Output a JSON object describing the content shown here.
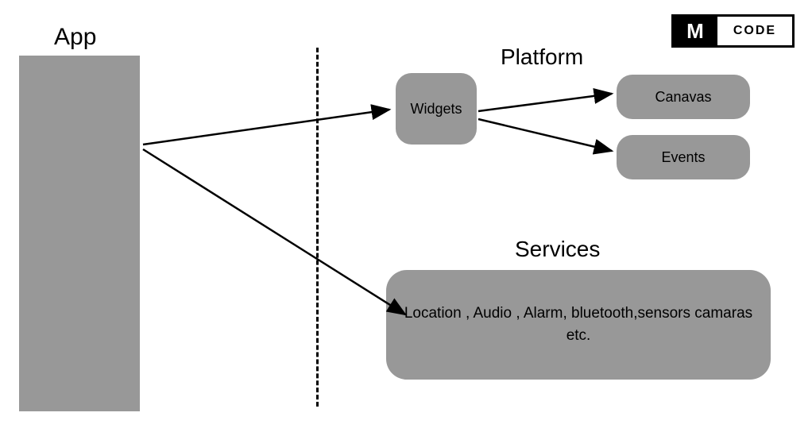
{
  "logo": {
    "mark": "M",
    "text": "CODE"
  },
  "app": {
    "label": "App"
  },
  "platform": {
    "label": "Platform",
    "widgets": "Widgets",
    "canvas": "Canavas",
    "events": "Events"
  },
  "services": {
    "label": "Services",
    "content": "Location , Audio , Alarm, bluetooth,sensors camaras etc."
  }
}
